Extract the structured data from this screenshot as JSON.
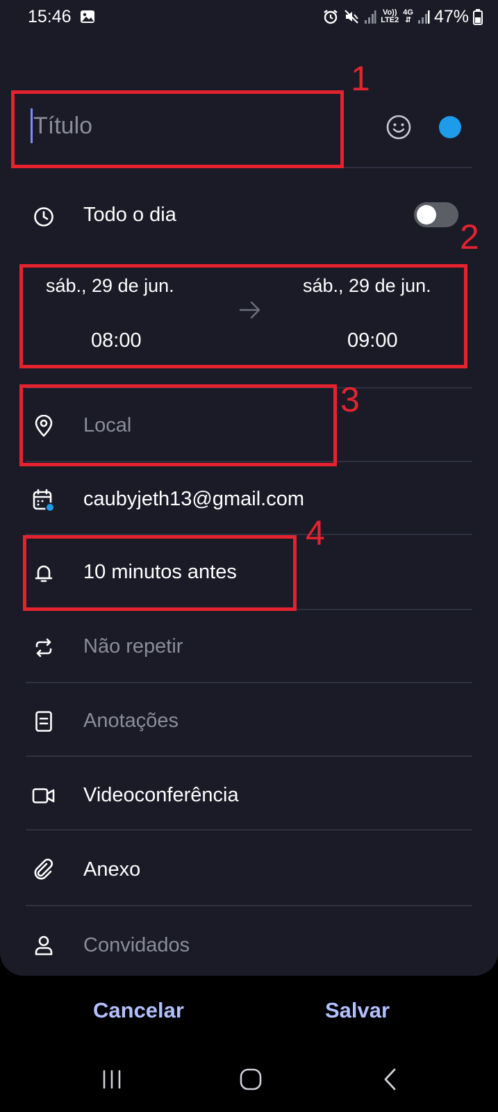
{
  "status_bar": {
    "time": "15:46",
    "battery": "47%",
    "network_small_top": "Vo))",
    "network_small_bottom": "LTE2",
    "network_4g": "4G"
  },
  "title": {
    "placeholder": "Título",
    "value": ""
  },
  "event_color": "#1e9be9",
  "all_day": {
    "label": "Todo o dia",
    "enabled": false
  },
  "date_range": {
    "start_date": "sáb., 29 de jun.",
    "start_time": "08:00",
    "end_date": "sáb., 29 de jun.",
    "end_time": "09:00"
  },
  "rows": {
    "location": "Local",
    "calendar": "caubyjeth13@gmail.com",
    "reminder": "10 minutos antes",
    "repeat": "Não repetir",
    "notes": "Anotações",
    "video": "Videoconferência",
    "attachment": "Anexo",
    "guests": "Convidados"
  },
  "actions": {
    "cancel": "Cancelar",
    "save": "Salvar"
  },
  "annotations": {
    "n1": "1",
    "n2": "2",
    "n3": "3",
    "n4": "4"
  },
  "colors": {
    "background": "#1a1b27",
    "accent_text": "#b3c0ff",
    "annotation_red": "#e4232e",
    "calendar_dot": "#1e9be9"
  }
}
